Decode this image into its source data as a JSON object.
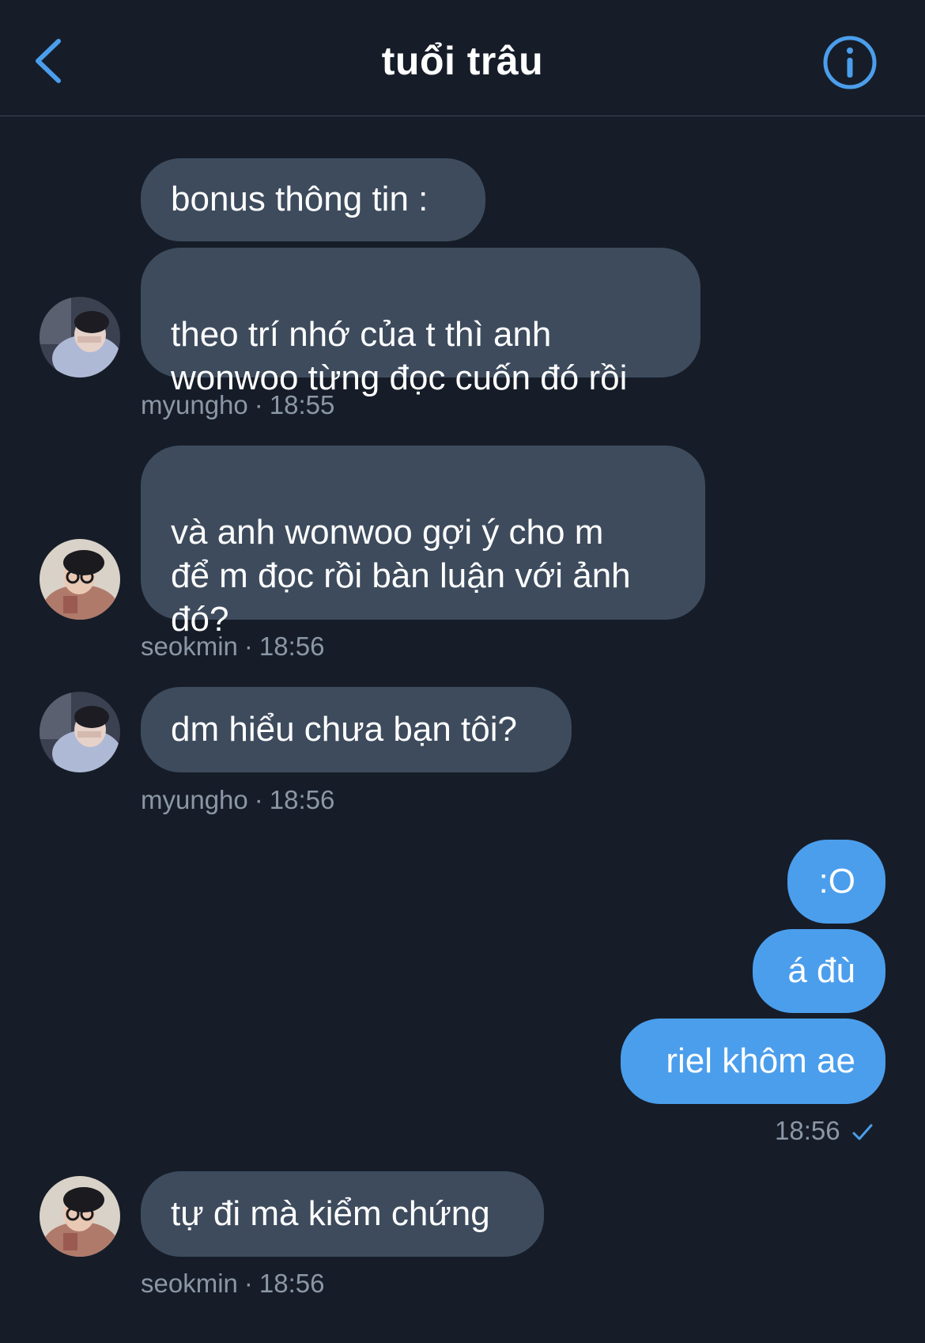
{
  "header": {
    "title": "tuổi trâu"
  },
  "colors": {
    "background": "#161d28",
    "incoming_bubble": "#3d4b5d",
    "outgoing_bubble": "#4b9eec",
    "accent": "#4b9eec",
    "meta_text": "#8b97a6"
  },
  "icons": {
    "back": "chevron-left-icon",
    "info": "info-circle-icon",
    "sent": "checkmark-icon"
  },
  "messages": [
    {
      "sender": "myungho",
      "time": "18:55",
      "lines": [
        "bonus thông tin :",
        "theo trí nhớ của t thì anh\nwonwoo từng đọc cuốn đó rồi"
      ]
    },
    {
      "sender": "seokmin",
      "time": "18:56",
      "lines": [
        "và anh wonwoo gợi ý cho m\nđể m đọc rồi bàn luận với ảnh\nđó?"
      ]
    },
    {
      "sender": "myungho",
      "time": "18:56",
      "lines": [
        "dm hiểu chưa bạn tôi?"
      ]
    },
    {
      "sender": "me",
      "time": "18:56",
      "lines": [
        ":O",
        "á đù",
        "riel khôm ae"
      ]
    },
    {
      "sender": "seokmin",
      "time": "18:56",
      "lines": [
        "tự đi mà kiểm chứng"
      ]
    }
  ],
  "meta_separator": "·"
}
